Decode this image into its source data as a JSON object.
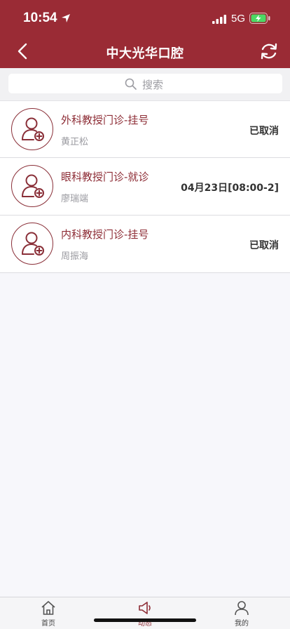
{
  "status_bar": {
    "time": "10:54",
    "network": "5G"
  },
  "nav": {
    "title": "中大光华口腔",
    "back_icon": "chevron-left-icon",
    "refresh_icon": "refresh-icon"
  },
  "search": {
    "placeholder": "搜索"
  },
  "items": [
    {
      "title": "外科教授门诊-挂号",
      "doctor": "黄正松",
      "status": "已取消"
    },
    {
      "title": "眼科教授门诊-就诊",
      "doctor": "廖瑞端",
      "status": "04月23日[08:00-2]"
    },
    {
      "title": "内科教授门诊-挂号",
      "doctor": "周振海",
      "status": "已取消"
    }
  ],
  "tabs": [
    {
      "label": "首页",
      "icon": "home-icon"
    },
    {
      "label": "动态",
      "icon": "megaphone-icon"
    },
    {
      "label": "我的",
      "icon": "person-icon"
    }
  ],
  "colors": {
    "brand": "#9a2b35",
    "accent_text": "#8d2c35"
  }
}
